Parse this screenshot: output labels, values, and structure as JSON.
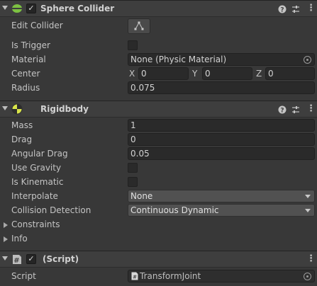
{
  "sphere_collider": {
    "title": "Sphere Collider",
    "edit_collider_label": "Edit Collider",
    "is_trigger_label": "Is Trigger",
    "material_label": "Material",
    "material_value": "None (Physic Material)",
    "center_label": "Center",
    "center": {
      "x_label": "X",
      "x": "0",
      "y_label": "Y",
      "y": "0",
      "z_label": "Z",
      "z": "0"
    },
    "radius_label": "Radius",
    "radius_value": "0.075"
  },
  "rigidbody": {
    "title": "Rigidbody",
    "mass_label": "Mass",
    "mass_value": "1",
    "drag_label": "Drag",
    "drag_value": "0",
    "angular_drag_label": "Angular Drag",
    "angular_drag_value": "0.05",
    "use_gravity_label": "Use Gravity",
    "is_kinematic_label": "Is Kinematic",
    "interpolate_label": "Interpolate",
    "interpolate_value": "None",
    "collision_detection_label": "Collision Detection",
    "collision_detection_value": "Continuous Dynamic",
    "constraints_label": "Constraints",
    "info_label": "Info"
  },
  "script_component": {
    "title": "(Script)",
    "script_label": "Script",
    "script_value": "TransformJoint"
  },
  "icons": {
    "help": "help-icon",
    "presets": "presets-icon",
    "menu": "kebab-menu-icon",
    "collider": "sphere-collider-icon",
    "rigidbody": "rigidbody-icon",
    "script": "script-icon"
  },
  "colors": {
    "collider_green": "#7dc242",
    "rigidbody_yellow": "#d8e44a",
    "background": "#383838",
    "header": "#3e3e3e"
  }
}
